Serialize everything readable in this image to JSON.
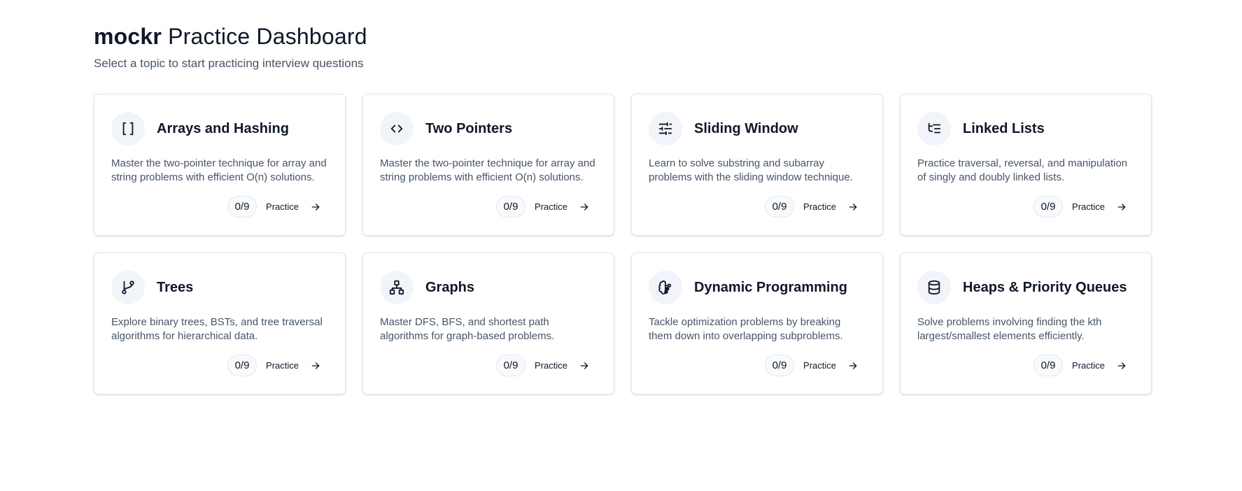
{
  "header": {
    "brand": "mockr",
    "title": "Practice Dashboard",
    "subtitle": "Select a topic to start practicing interview questions"
  },
  "topics": [
    {
      "title": "Arrays and Hashing",
      "description": "Master the two-pointer technique for array and string problems with efficient O(n) solutions.",
      "progress": "0/9",
      "action": "Practice",
      "icon": "brackets-icon"
    },
    {
      "title": "Two Pointers",
      "description": "Master the two-pointer technique for array and string problems with efficient O(n) solutions.",
      "progress": "0/9",
      "action": "Practice",
      "icon": "code-icon"
    },
    {
      "title": "Sliding Window",
      "description": "Learn to solve substring and subarray problems with the sliding window technique.",
      "progress": "0/9",
      "action": "Practice",
      "icon": "sliders-icon"
    },
    {
      "title": "Linked Lists",
      "description": "Practice traversal, reversal, and manipulation of singly and doubly linked lists.",
      "progress": "0/9",
      "action": "Practice",
      "icon": "list-tree-icon"
    },
    {
      "title": "Trees",
      "description": "Explore binary trees, BSTs, and tree traversal algorithms for hierarchical data.",
      "progress": "0/9",
      "action": "Practice",
      "icon": "git-branch-icon"
    },
    {
      "title": "Graphs",
      "description": "Master DFS, BFS, and shortest path algorithms for graph-based problems.",
      "progress": "0/9",
      "action": "Practice",
      "icon": "network-icon"
    },
    {
      "title": "Dynamic Programming",
      "description": "Tackle optimization problems by breaking them down into overlapping subproblems.",
      "progress": "0/9",
      "action": "Practice",
      "icon": "brain-icon"
    },
    {
      "title": "Heaps & Priority Queues",
      "description": "Solve problems involving finding the kth largest/smallest elements efficiently.",
      "progress": "0/9",
      "action": "Practice",
      "icon": "database-icon"
    }
  ]
}
